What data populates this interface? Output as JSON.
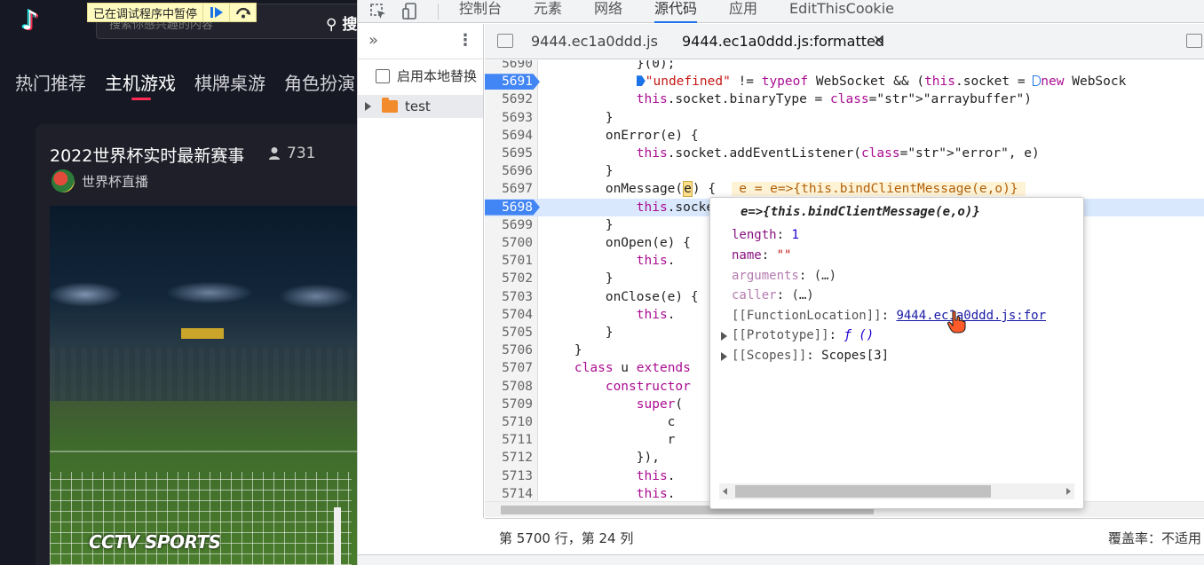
{
  "site": {
    "logo": "♪",
    "search_placeholder": "搜索你感兴趣的内容",
    "search_button": "搜",
    "nav": [
      "热门推荐",
      "主机游戏",
      "棋牌桌游",
      "角色扮演"
    ],
    "nav_active_index": 1,
    "stream_title": "2022世界杯实时最新赛事",
    "viewer_count": "731",
    "channel_name": "世界杯直播",
    "watermark": "CCTV SPORTS",
    "accent_color": "#fe2c55"
  },
  "paused_overlay": {
    "text": "已在调试程序中暂停",
    "resume_icon": "resume-icon",
    "step_icon": "step-over-icon"
  },
  "devtools": {
    "top_tabs": [
      "控制台",
      "元素",
      "网络",
      "源代码",
      "应用",
      "EditThisCookie"
    ],
    "active_tab": "源代码",
    "navigator": {
      "override_label": "启用本地替换",
      "tree": [
        {
          "label": "test",
          "type": "folder"
        }
      ]
    },
    "editor_tabs": [
      "9444.ec1a0ddd.js",
      "9444.ec1a0ddd.js:formatted"
    ],
    "active_editor_tab": "9444.ec1a0ddd.js:formatted",
    "code": {
      "exec_line": "5698",
      "breakpoint_lines": [
        "5691",
        "5698"
      ],
      "lines": [
        {
          "n": "5690",
          "t": "            }(0);"
        },
        {
          "n": "5691",
          "t": ""
        },
        {
          "n": "5692",
          "t": "            this.socket.binaryType = \"arraybuffer\")"
        },
        {
          "n": "5693",
          "t": "        }"
        },
        {
          "n": "5694",
          "t": "        onError(e) {"
        },
        {
          "n": "5695",
          "t": "            this.socket.addEventListener(\"error\", e)"
        },
        {
          "n": "5696",
          "t": "        }"
        },
        {
          "n": "5697",
          "t": ""
        },
        {
          "n": "5698",
          "t": "            this.socket.addEventListener(\"message\", e)"
        },
        {
          "n": "5699",
          "t": "        }"
        },
        {
          "n": "5700",
          "t": "        onOpen(e) {"
        },
        {
          "n": "5701",
          "t": "            this."
        },
        {
          "n": "5702",
          "t": "        }"
        },
        {
          "n": "5703",
          "t": "        onClose(e) {"
        },
        {
          "n": "5704",
          "t": "            this."
        },
        {
          "n": "5705",
          "t": "        }"
        },
        {
          "n": "5706",
          "t": "    }"
        },
        {
          "n": "5707",
          "t": "    class u extends"
        },
        {
          "n": "5708",
          "t": "        constructor"
        },
        {
          "n": "5709",
          "t": "            super("
        },
        {
          "n": "5710",
          "t": "                c"
        },
        {
          "n": "5711",
          "t": "                r"
        },
        {
          "n": "5712",
          "t": "            }),"
        },
        {
          "n": "5713",
          "t": "            this."
        },
        {
          "n": "5714",
          "t": "            this."
        }
      ],
      "line_5691_string": "\"undefined\"",
      "line_5691_rest": " != typeof WebSocket && (this.socket = ",
      "line_5691_new": "new WebSock",
      "line_5697_prefix": "        onMessage(",
      "line_5697_param": "e",
      "line_5697_suffix": ") {  ",
      "line_5697_inline": "e = e=>{this.bindClientMessage(e,o)}"
    },
    "status": {
      "position": "第 5700 行，第 24 列",
      "coverage": "覆盖率：不适用"
    },
    "popover": {
      "title": "e=>{this.bindClientMessage(e,o)}",
      "rows": [
        {
          "key": "length",
          "sep": ": ",
          "value": "1",
          "kind": "num"
        },
        {
          "key": "name",
          "sep": ": ",
          "value": "\"\"",
          "kind": "str"
        },
        {
          "key": "arguments",
          "sep": ": ",
          "value": "(…)",
          "kind": "dim"
        },
        {
          "key": "caller",
          "sep": ": ",
          "value": "(…)",
          "kind": "dim"
        },
        {
          "key": "[[FunctionLocation]]",
          "sep": ": ",
          "value": "9444.ec1a0ddd.js:for",
          "kind": "link"
        },
        {
          "key": "[[Prototype]]",
          "sep": ": ",
          "value": "ƒ ()",
          "kind": "fn"
        },
        {
          "key": "[[Scopes]]",
          "sep": ": ",
          "value": "Scopes[3]",
          "kind": "plain"
        }
      ]
    }
  }
}
